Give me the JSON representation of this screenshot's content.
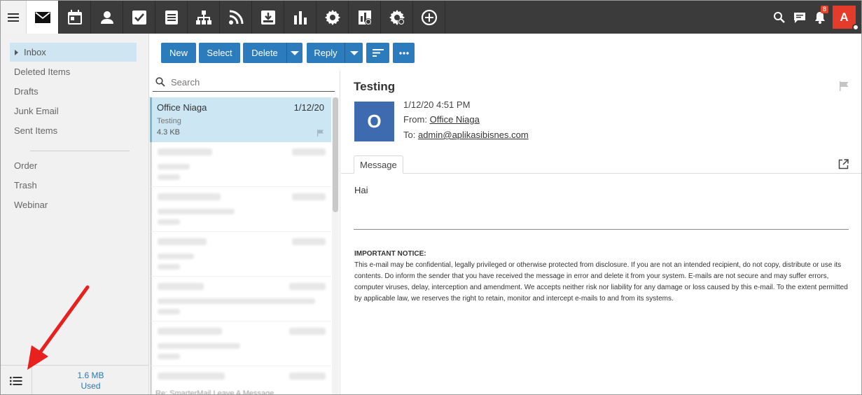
{
  "topbar": {
    "nav": [
      {
        "icon": "mail-icon"
      },
      {
        "icon": "calendar-icon"
      },
      {
        "icon": "contacts-icon"
      },
      {
        "icon": "tasks-icon"
      },
      {
        "icon": "notes-icon"
      },
      {
        "icon": "file-tree-icon"
      },
      {
        "icon": "rss-icon"
      },
      {
        "icon": "download-box-icon"
      },
      {
        "icon": "reports-icon"
      },
      {
        "icon": "settings-icon"
      },
      {
        "icon": "domain-reports-icon"
      },
      {
        "icon": "domain-settings-icon"
      },
      {
        "icon": "add-circle-icon"
      }
    ],
    "notification_count": "8",
    "avatar_letter": "A"
  },
  "sidebar": {
    "folders": [
      {
        "label": "Inbox"
      },
      {
        "label": "Deleted Items"
      },
      {
        "label": "Drafts"
      },
      {
        "label": "Junk Email"
      },
      {
        "label": "Sent Items"
      },
      {
        "label": "Order"
      },
      {
        "label": "Trash"
      },
      {
        "label": "Webinar"
      }
    ],
    "usage_size": "1.6 MB",
    "usage_label": "Used"
  },
  "toolbar": {
    "new": "New",
    "select": "Select",
    "delete": "Delete",
    "reply": "Reply"
  },
  "list": {
    "search_placeholder": "Search",
    "selected": {
      "from": "Office Niaga",
      "date": "1/12/20",
      "subject": "Testing",
      "size": "4.3 KB"
    },
    "last_row_hint": "Re: SmarterMail Leave A Message"
  },
  "message": {
    "subject": "Testing",
    "avatar_letter": "O",
    "datetime": "1/12/20 4:51 PM",
    "from_label": "From:",
    "from": "Office Niaga",
    "to_label": "To:",
    "to": "admin@aplikasibisnes.com",
    "tab": "Message",
    "body": "Hai",
    "notice_title": "IMPORTANT NOTICE:",
    "notice_text": "This e-mail may be confidential, legally privileged or otherwise protected from disclosure. If you are not an intended recipient, do not copy, distribute or use its contents. Do inform the sender that you have received the message in error and delete it from your system. E-mails are not secure and may suffer errors, computer viruses, delay, interception and amendment. We accepts neither risk nor liability for any damage or loss caused by this e-mail. To the extent permitted by applicable law, we reserves the right to retain, monitor and intercept e-mails to and from its systems."
  },
  "colors": {
    "primary_button": "#2b7bbd",
    "topbar": "#3b3b3b",
    "avatar": "#e53b2b",
    "sender_avatar": "#3e6bb0",
    "selected_row": "#cde6f3",
    "annotation_arrow": "#e8201e"
  }
}
